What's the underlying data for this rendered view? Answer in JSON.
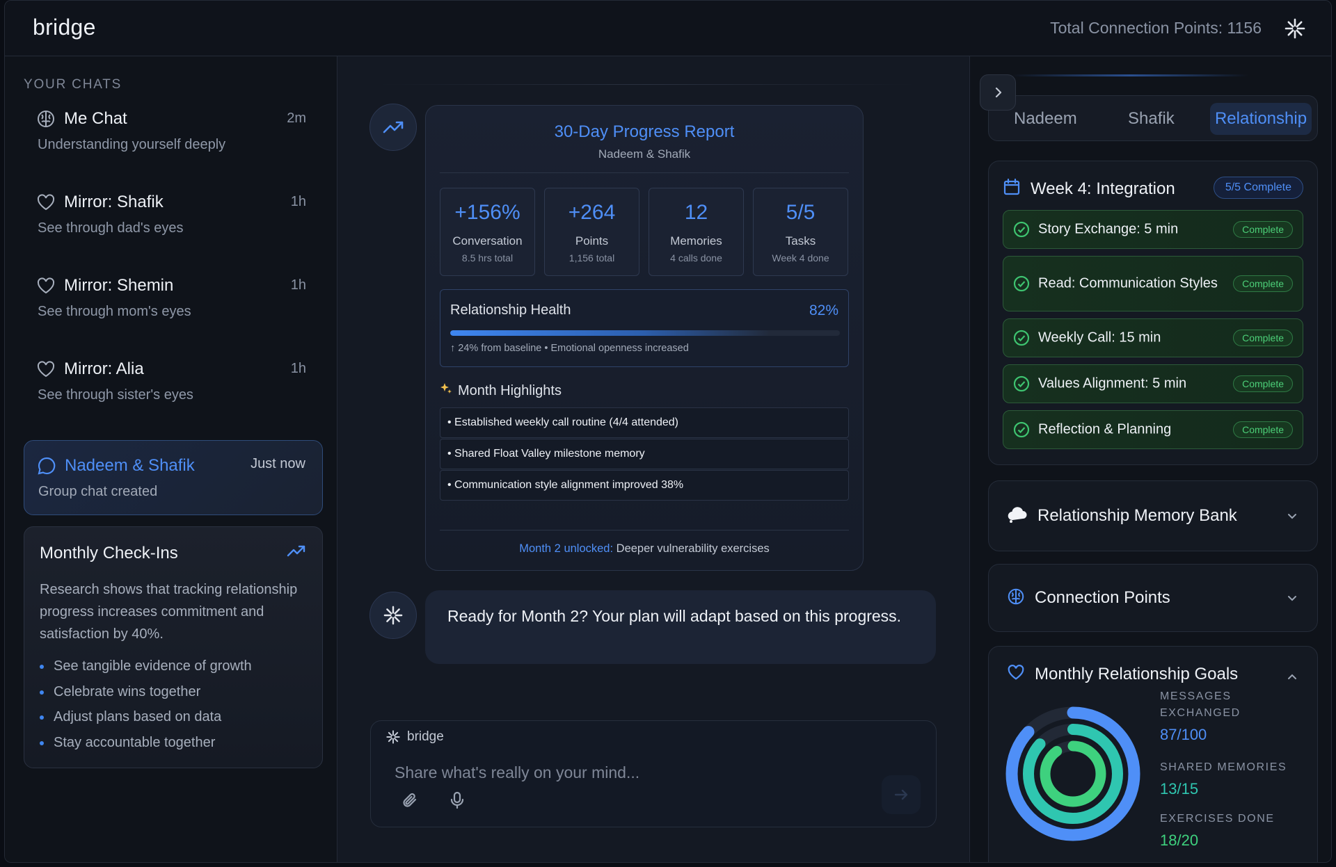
{
  "header": {
    "logo": "bridge",
    "total_points": "Total Connection Points: 1156"
  },
  "sidebar": {
    "title": "YOUR CHATS",
    "chats": [
      {
        "title": "Me Chat",
        "subtitle": "Understanding yourself deeply",
        "time": "2m",
        "icon": "brain-icon"
      },
      {
        "title": "Mirror: Shafik",
        "subtitle": "See through dad's eyes",
        "time": "1h",
        "icon": "heart-icon"
      },
      {
        "title": "Mirror: Shemin",
        "subtitle": "See through mom's eyes",
        "time": "1h",
        "icon": "heart-icon"
      },
      {
        "title": "Mirror: Alia",
        "subtitle": "See through sister's eyes",
        "time": "1h",
        "icon": "heart-icon"
      },
      {
        "title": "Nadeem & Shafik",
        "subtitle": "Group chat created",
        "time": "Just now",
        "icon": "chat-bubble-icon"
      }
    ],
    "checkins": {
      "title": "Monthly Check-Ins",
      "text": "Research shows that tracking relationship progress increases commitment and satisfaction by 40%.",
      "items": [
        "See tangible evidence of growth",
        "Celebrate wins together",
        "Adjust plans based on data",
        "Stay accountable together"
      ]
    }
  },
  "report": {
    "title": "30-Day Progress Report",
    "subtitle": "Nadeem & Shafik",
    "stats": [
      {
        "value": "+156%",
        "label": "Conversation",
        "sub": "8.5 hrs total"
      },
      {
        "value": "+264",
        "label": "Points",
        "sub": "1,156 total"
      },
      {
        "value": "12",
        "label": "Memories",
        "sub": "4 calls done"
      },
      {
        "value": "5/5",
        "label": "Tasks",
        "sub": "Week 4 done"
      }
    ],
    "health": {
      "label": "Relationship Health",
      "percent_text": "82%",
      "percent": 82,
      "note": "↑ 24% from baseline • Emotional openness increased"
    },
    "highlights_title": "Month Highlights",
    "highlights": [
      "• Established weekly call routine (4/4 attended)",
      "• Shared Float Valley milestone memory",
      "• Communication style alignment improved 38%"
    ],
    "footer_highlight": "Month 2 unlocked:",
    "footer_rest": " Deeper vulnerability exercises"
  },
  "message": {
    "text": "Ready for Month 2? Your plan will adapt based on this progress."
  },
  "composer": {
    "brand": "bridge",
    "placeholder": "Share what's really on your mind..."
  },
  "right_panel": {
    "tabs": [
      "Nadeem",
      "Shafik",
      "Relationship"
    ],
    "active_tab": "Relationship",
    "week": {
      "title": "Week 4: Integration",
      "badge": "5/5 Complete",
      "tasks": [
        {
          "label": "Story Exchange: 5 min",
          "status": "Complete"
        },
        {
          "label": "Read: Communication Styles",
          "status": "Complete"
        },
        {
          "label": "Weekly Call: 15 min",
          "status": "Complete"
        },
        {
          "label": "Values Alignment: 5 min",
          "status": "Complete"
        },
        {
          "label": "Reflection & Planning",
          "status": "Complete"
        }
      ]
    },
    "memory_bank": {
      "title": "Relationship Memory Bank"
    },
    "connection_points": {
      "title": "Connection Points"
    },
    "goals": {
      "title": "Monthly Relationship Goals",
      "stats": [
        {
          "label": "MESSAGES EXCHANGED",
          "value": "87/100",
          "current": 87,
          "target": 100,
          "color": "#4f8ff7"
        },
        {
          "label": "SHARED MEMORIES",
          "value": "13/15",
          "current": 13,
          "target": 15,
          "color": "#2fc6b0"
        },
        {
          "label": "EXERCISES DONE",
          "value": "18/20",
          "current": 18,
          "target": 20,
          "color": "#3ed17e"
        }
      ]
    }
  }
}
